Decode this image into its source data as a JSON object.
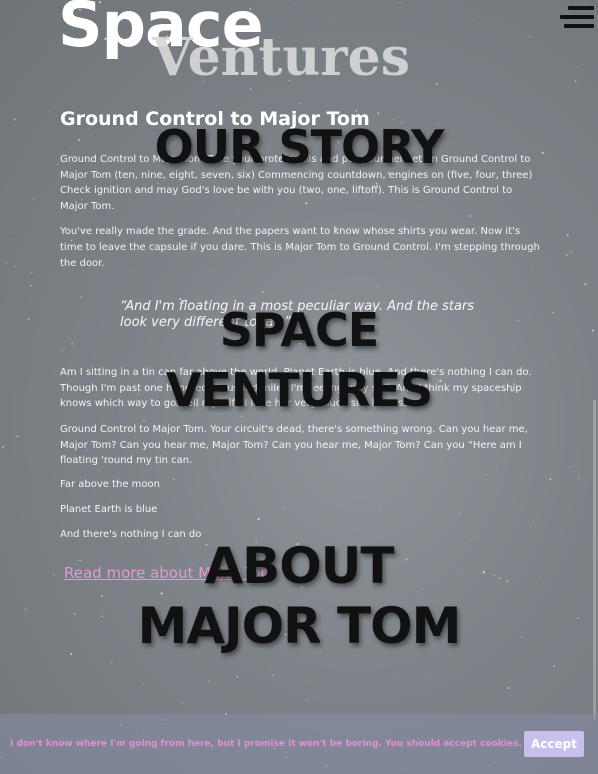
{
  "brand": {
    "word1": "Space",
    "word2": "Ventures"
  },
  "menu": {
    "icon": "hamburger-menu-icon"
  },
  "article": {
    "heading": "Ground Control to Major Tom",
    "paragraphs": [
      "Ground Control to Major Tom Take your protein pills and put your helmet on Ground Control to Major Tom (ten, nine, eight, seven, six) Commencing countdown, engines on (five, four, three) Check ignition and may God's love be with you (two, one, liftoff). This is Ground Control to Major Tom.",
      "You've really made the grade. And the papers want to know whose shirts you wear. Now it's time to leave the capsule if you dare. This is Major Tom to Ground Control. I'm stepping through the door."
    ],
    "quote": "“And I'm floating in a most peculiar way. And the stars look very different today.”",
    "paragraphs2": [
      "Am I sitting in a tin can far above the world. Planet Earth is blue. And there's nothing I can do. Though I'm past one hundred thousand miles I'm feeling very still. And I think my spaceship knows which way to go. Tell my wife I love her very much she knows.",
      "Ground Control to Major Tom. Your circuit's dead, there's something wrong. Can you hear me, Major Tom? Can you hear me, Major Tom? Can you hear me, Major Tom? Can you “Here am I floating 'round my tin can."
    ],
    "lines": [
      "Far above the moon",
      "Planet Earth is blue",
      "And there's nothing I can do"
    ],
    "read_more": "Read more about Major Tom"
  },
  "overlay": {
    "section1": "OUR STORY",
    "section2_line1": "SPACE",
    "section2_line2": "VENTURES",
    "section3_line1": "ABOUT",
    "section3_line2": "MAJOR TOM"
  },
  "cookie": {
    "message": "I don't know where I'm going from here, but I promise it won't be boring. You should accept cookies.",
    "accept_label": "Accept"
  },
  "colors": {
    "link": "#e59ad2",
    "cookie_bar": "#878caa",
    "accept_button": "#c7c0ea"
  }
}
